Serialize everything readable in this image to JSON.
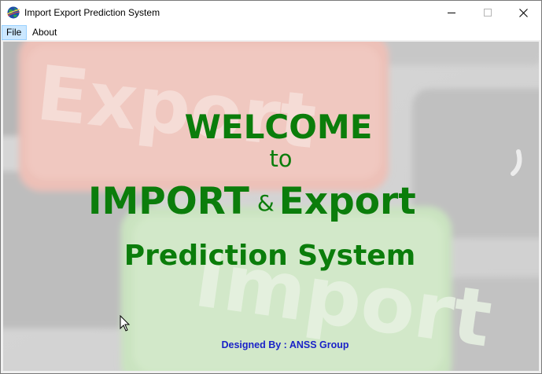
{
  "window": {
    "title": "Import Export Prediction System",
    "controls": {
      "minimize": "minimize",
      "maximize": "maximize",
      "close": "close"
    }
  },
  "menu": {
    "items": [
      {
        "label": "File"
      },
      {
        "label": "About"
      }
    ]
  },
  "splash": {
    "welcome": "WELCOME",
    "to": "to",
    "import": "IMPORT",
    "amp": "&",
    "export": "Export",
    "prediction": "Prediction System",
    "credit": "Designed By : ANSS Group",
    "background_keys": [
      "Export",
      "Import"
    ]
  },
  "colors": {
    "headline": "#0b7d0b",
    "credit": "#1a22c8",
    "menu_highlight": "#cce8ff"
  }
}
